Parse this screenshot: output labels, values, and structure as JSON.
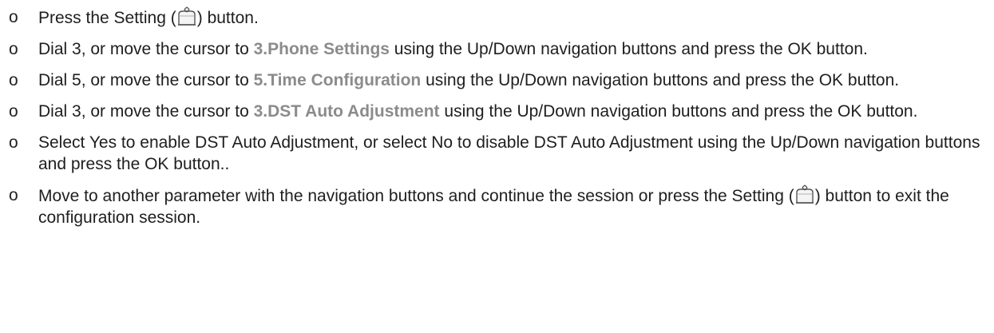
{
  "steps": [
    {
      "bullet": "o",
      "pre": "Press the Setting (",
      "post": ") button."
    },
    {
      "bullet": "o",
      "pre": "Dial 3, or move the cursor to ",
      "highlight": "3.Phone Settings",
      "post": " using the Up/Down navigation buttons and press the OK button."
    },
    {
      "bullet": "o",
      "pre": "Dial 5, or move the cursor to ",
      "highlight": "5.Time Configuration",
      "post": " using the Up/Down navigation buttons and press the OK button."
    },
    {
      "bullet": "o",
      "pre": "Dial 3, or move the cursor to ",
      "highlight": "3.DST Auto Adjustment",
      "post": " using the Up/Down navigation buttons and press the OK button."
    },
    {
      "bullet": "o",
      "text": "Select Yes to enable DST Auto Adjustment, or select No to disable DST Auto Adjustment using the Up/Down navigation buttons and press the OK button.."
    },
    {
      "bullet": "o",
      "pre": "Move to another parameter with the navigation buttons and continue the session or press the Setting (",
      "post": ") button to exit the configuration session."
    }
  ],
  "icons": {
    "setting": "setting-button-icon"
  }
}
